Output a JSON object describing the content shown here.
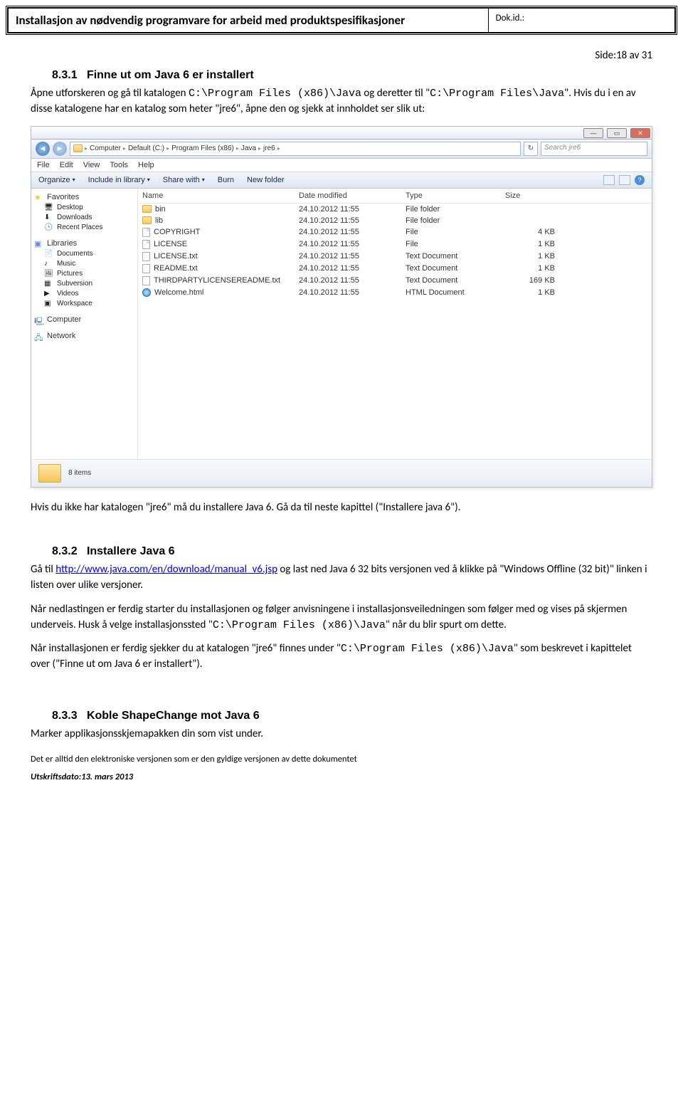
{
  "header": {
    "title": "Installasjon av nødvendig programvare for arbeid med produktspesifikasjoner",
    "docid_label": "Dok.id.:"
  },
  "page_side": "Side:18 av 31",
  "sec1": {
    "num": "8.3.1",
    "title": "Finne ut om Java 6 er installert",
    "p1a": "Åpne utforskeren og gå til katalogen ",
    "p1code1": "C:\\Program Files (x86)\\Java",
    "p1b": " og deretter til \"",
    "p1code2": "C:\\Program Files\\Java",
    "p1c": "\". Hvis du i en av disse katalogene har en katalog som heter \"jre6\", åpne den og sjekk at innholdet ser slik ut:"
  },
  "screenshot": {
    "crumbs": [
      "Computer",
      "Default (C:)",
      "Program Files (x86)",
      "Java",
      "jre6"
    ],
    "search_placeholder": "Search jre6",
    "menu": [
      "File",
      "Edit",
      "View",
      "Tools",
      "Help"
    ],
    "toolbar": {
      "organize": "Organize",
      "include": "Include in library",
      "share": "Share with",
      "burn": "Burn",
      "newfolder": "New folder"
    },
    "side": {
      "favorites": "Favorites",
      "fav_items": [
        "Desktop",
        "Downloads",
        "Recent Places"
      ],
      "libraries": "Libraries",
      "lib_items": [
        "Documents",
        "Music",
        "Pictures",
        "Subversion",
        "Videos",
        "Workspace"
      ],
      "computer": "Computer",
      "network": "Network"
    },
    "cols": [
      "Name",
      "Date modified",
      "Type",
      "Size"
    ],
    "rows": [
      {
        "icon": "folder",
        "name": "bin",
        "date": "24.10.2012 11:55",
        "type": "File folder",
        "size": ""
      },
      {
        "icon": "folder",
        "name": "lib",
        "date": "24.10.2012 11:55",
        "type": "File folder",
        "size": ""
      },
      {
        "icon": "file",
        "name": "COPYRIGHT",
        "date": "24.10.2012 11:55",
        "type": "File",
        "size": "4 KB"
      },
      {
        "icon": "file",
        "name": "LICENSE",
        "date": "24.10.2012 11:55",
        "type": "File",
        "size": "1 KB"
      },
      {
        "icon": "txt",
        "name": "LICENSE.txt",
        "date": "24.10.2012 11:55",
        "type": "Text Document",
        "size": "1 KB"
      },
      {
        "icon": "txt",
        "name": "README.txt",
        "date": "24.10.2012 11:55",
        "type": "Text Document",
        "size": "1 KB"
      },
      {
        "icon": "txt",
        "name": "THIRDPARTYLICENSEREADME.txt",
        "date": "24.10.2012 11:55",
        "type": "Text Document",
        "size": "169 KB"
      },
      {
        "icon": "html",
        "name": "Welcome.html",
        "date": "24.10.2012 11:55",
        "type": "HTML Document",
        "size": "1 KB"
      }
    ],
    "status": "8 items"
  },
  "after_ss": "Hvis du ikke har katalogen \"jre6\" må du installere Java 6. Gå da til neste kapittel (\"Installere java 6\").",
  "sec2": {
    "num": "8.3.2",
    "title": "Installere Java 6",
    "p1a": "Gå til ",
    "link": "http://www.java.com/en/download/manual_v6.jsp",
    "p1b": " og last ned Java 6 32 bits versjonen ved å klikke på \"Windows Offline (32 bit)\" linken i listen over ulike versjoner.",
    "p2a": "Når nedlastingen er ferdig starter du installasjonen og følger anvisningene i installasjonsveiledningen som følger med og vises på skjermen underveis. Husk å velge installasjonssted \"",
    "p2code": "C:\\Program Files (x86)\\Java",
    "p2b": "\" når du blir spurt om dette.",
    "p3a": "Når installasjonen er ferdig sjekker du at katalogen \"jre6\" finnes under \"",
    "p3code": "C:\\Program Files (x86)\\Java",
    "p3b": "\" som beskrevet i kapittelet over (\"Finne ut om Java 6 er installert\")."
  },
  "sec3": {
    "num": "8.3.3",
    "title": "Koble ShapeChange mot Java 6",
    "p1": "Marker applikasjonsskjemapakken din som vist under."
  },
  "footer": {
    "note": "Det er alltid den elektroniske versjonen som er den gyldige versjonen av dette dokumentet",
    "date": "Utskriftsdato:13. mars 2013"
  }
}
